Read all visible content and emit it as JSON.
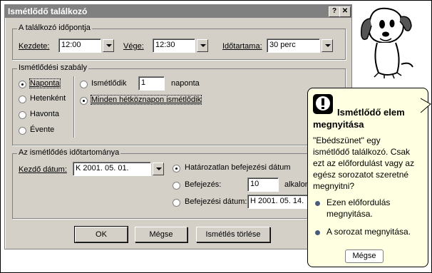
{
  "dialog": {
    "title": "Ismétlődő találkozó",
    "help_label": "?",
    "close_label": "✕"
  },
  "appointment_time": {
    "legend": "A találkozó időpontja",
    "start_label": "Kezdete:",
    "start_value": "12:00",
    "end_label": "Vége:",
    "end_value": "12:30",
    "duration_label": "Időtartama:",
    "duration_value": "30 perc"
  },
  "recurrence_pattern": {
    "legend": "Ismétlődési szabály",
    "daily": "Naponta",
    "weekly": "Hetenként",
    "monthly": "Havonta",
    "yearly": "Évente",
    "every_label": "Ismétlődik",
    "every_value": "1",
    "every_suffix": "naponta",
    "every_weekday": "Minden hétköznapon ismétlődik"
  },
  "range": {
    "legend": "Az ismétlődés időtartománya",
    "start_label": "Kezdő dátum:",
    "start_value": "K 2001. 05. 01.",
    "no_end": "Határozatlan befejezési dátum",
    "end_after_label": "Befejezés:",
    "end_after_value": "10",
    "end_after_suffix": "alkalom u",
    "end_by_label": "Befejezési dátum:",
    "end_by_value": "H 2001. 05. 14."
  },
  "buttons": {
    "ok": "OK",
    "cancel": "Mégse",
    "remove": "Ismétlés törlése"
  },
  "balloon": {
    "title_line1": "Ismétlődő elem",
    "title_line2": "megnyitása",
    "body_line1": "\"Ebédszünet\" egy",
    "body_line2": "ismétlődő találkozó. Csak",
    "body_line3": "ezt az előfordulást vagy az",
    "body_line4": "egész sorozatot szeretné",
    "body_line5": "megnyitni?",
    "option1_line1": "Ezen előfordulás",
    "option1_line2": "megnyitása.",
    "option2": "A sorozat megnyitása.",
    "cancel": "Mégse"
  }
}
